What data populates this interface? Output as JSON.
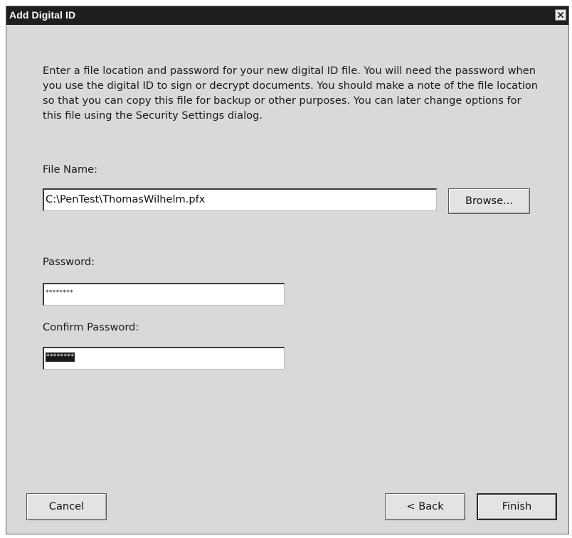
{
  "window": {
    "title": "Add Digital ID",
    "close_glyph": "close-icon"
  },
  "instructions": "Enter a file location and password for your new digital ID file. You will need the password when you use the digital ID to sign or decrypt documents. You should make a note of the file location so that you can copy this file for backup or other purposes. You can later change options for this file using the Security Settings dialog.",
  "form": {
    "file_name_label": "File Name:",
    "file_name_value": "C:\\PenTest\\ThomasWilhelm.pfx",
    "browse_label": "Browse...",
    "password_label": "Password:",
    "password_value": "********",
    "confirm_label": "Confirm Password:",
    "confirm_value": "********"
  },
  "buttons": {
    "cancel": "Cancel",
    "back": "< Back",
    "finish": "Finish"
  },
  "colors": {
    "titlebar": "#1e1e1e",
    "dialog_bg": "#d9d9d9",
    "selection": "#1a1a1a"
  }
}
